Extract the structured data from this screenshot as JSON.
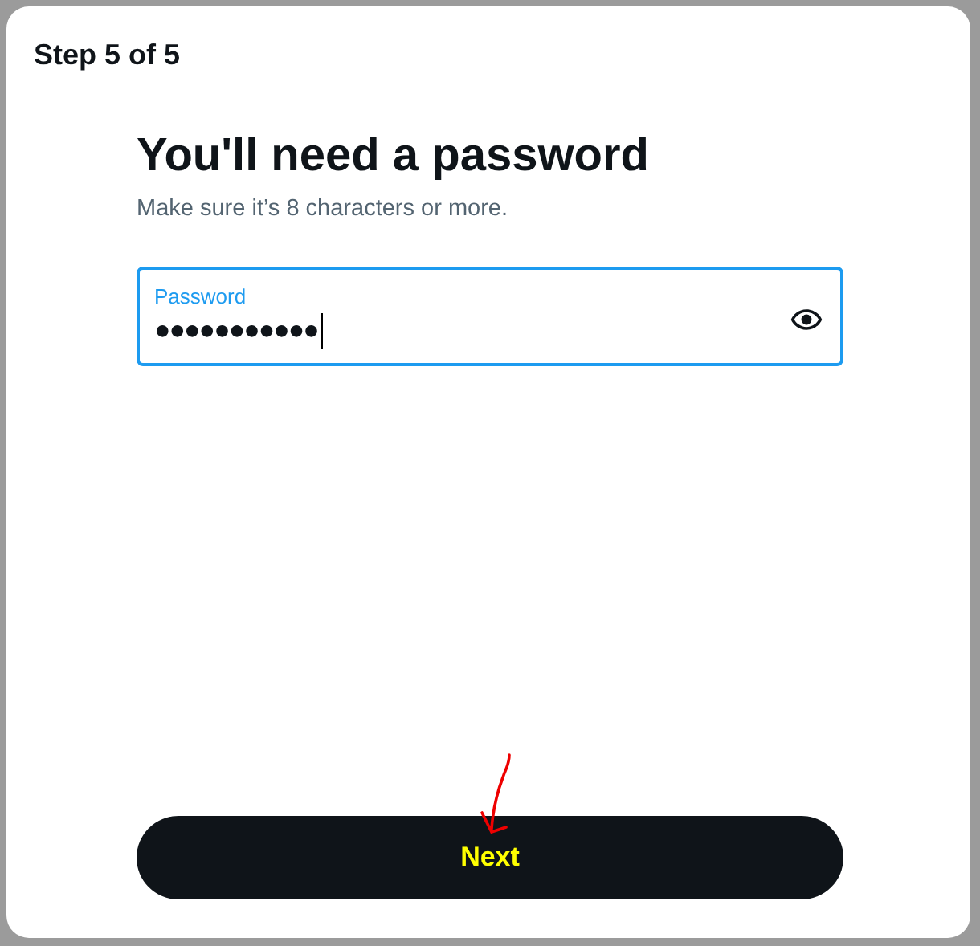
{
  "header": {
    "step": "Step 5 of 5"
  },
  "title": "You'll need a password",
  "subtitle": "Make sure it’s 8 characters or more.",
  "password_field": {
    "label": "Password",
    "value": "●●●●●●●●●●●",
    "focused": true
  },
  "next_button": {
    "label": "Next"
  }
}
